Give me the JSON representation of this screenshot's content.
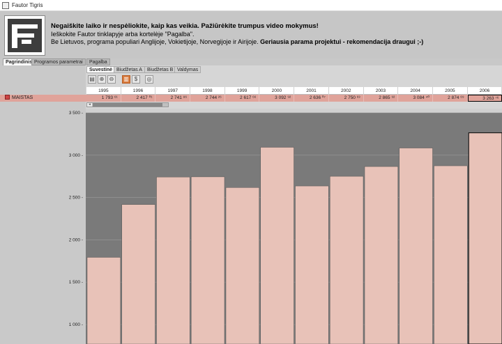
{
  "window": {
    "title": "Fautor Tigris"
  },
  "banner": {
    "line1": "Negaiškite laiko ir nespėliokite, kaip kas veikia. Pažiūrėkite trumpus video mokymus!",
    "line2": "Ieškokite Fautor tinklapyje arba kortelėje \"Pagalba\".",
    "line3_start": "Be Lietuvos, programa populiari Anglijoje, Vokietijoje, Norvegijoje ir Airijoje. ",
    "line3_bold": "Geriausia parama projektui - rekomendacija draugui ;-)"
  },
  "tabs": {
    "main": [
      {
        "label": "Pagrindinis"
      },
      {
        "label": "Programos parametrai"
      },
      {
        "label": "Pagalba"
      }
    ],
    "sub": [
      {
        "label": "Suvestinė"
      },
      {
        "label": "Biudžetas A"
      },
      {
        "label": "Biudžetas B"
      },
      {
        "label": "Valdymas"
      }
    ]
  },
  "toolbar": {
    "icons": [
      "save-icon",
      "zoom-in-icon",
      "zoom-out-icon",
      "bar-chart-icon",
      "currency-icon",
      "lifebuoy-icon"
    ],
    "glyphs": [
      "▤",
      "⊕",
      "⊖",
      "▥",
      "$",
      "◎"
    ]
  },
  "table": {
    "years": [
      "1995",
      "1996",
      "1997",
      "1998",
      "1999",
      "2000",
      "2001",
      "2002",
      "2003",
      "2004",
      "2005",
      "2006"
    ],
    "row": {
      "label": "MAISTAS",
      "values": [
        "1 793 ⁶¹",
        "2 417 ⁰¹",
        "2 741 ⁸⁶",
        "2 744 ²⁶",
        "2 617 ⁶⁶",
        "3 092 ⁹²",
        "2 636 ⁰⁷",
        "2 750 ⁶³",
        "2 865 ⁹²",
        "3 084 ⁴⁰",
        "2 874 ⁶⁹",
        "3 263 ⁷⁶"
      ]
    }
  },
  "colors": {
    "bar_fill": "#e8c2b8",
    "bar_stroke": "#555555",
    "plot_bg": "#7a7a7a",
    "row_fill": "#e0a39a"
  },
  "chart_data": {
    "type": "bar",
    "categories": [
      "1995",
      "1996",
      "1997",
      "1998",
      "1999",
      "2000",
      "2001",
      "2002",
      "2003",
      "2004",
      "2005",
      "2006"
    ],
    "series": [
      {
        "name": "MAISTAS",
        "values": [
          1793.61,
          2417.01,
          2741.86,
          2744.26,
          2617.66,
          3092.92,
          2636.07,
          2750.63,
          2865.92,
          3084.4,
          2874.69,
          3263.76
        ]
      }
    ],
    "y_ticks": [
      1000,
      1500,
      2000,
      2500,
      3000,
      3500
    ],
    "y_tick_labels": [
      "1 000 -",
      "1 500 -",
      "2 000 -",
      "2 500 -",
      "3 000 -",
      "3 500 -"
    ],
    "ylim": [
      770,
      3500
    ],
    "grid": true,
    "title": "",
    "xlabel": "",
    "ylabel": ""
  }
}
